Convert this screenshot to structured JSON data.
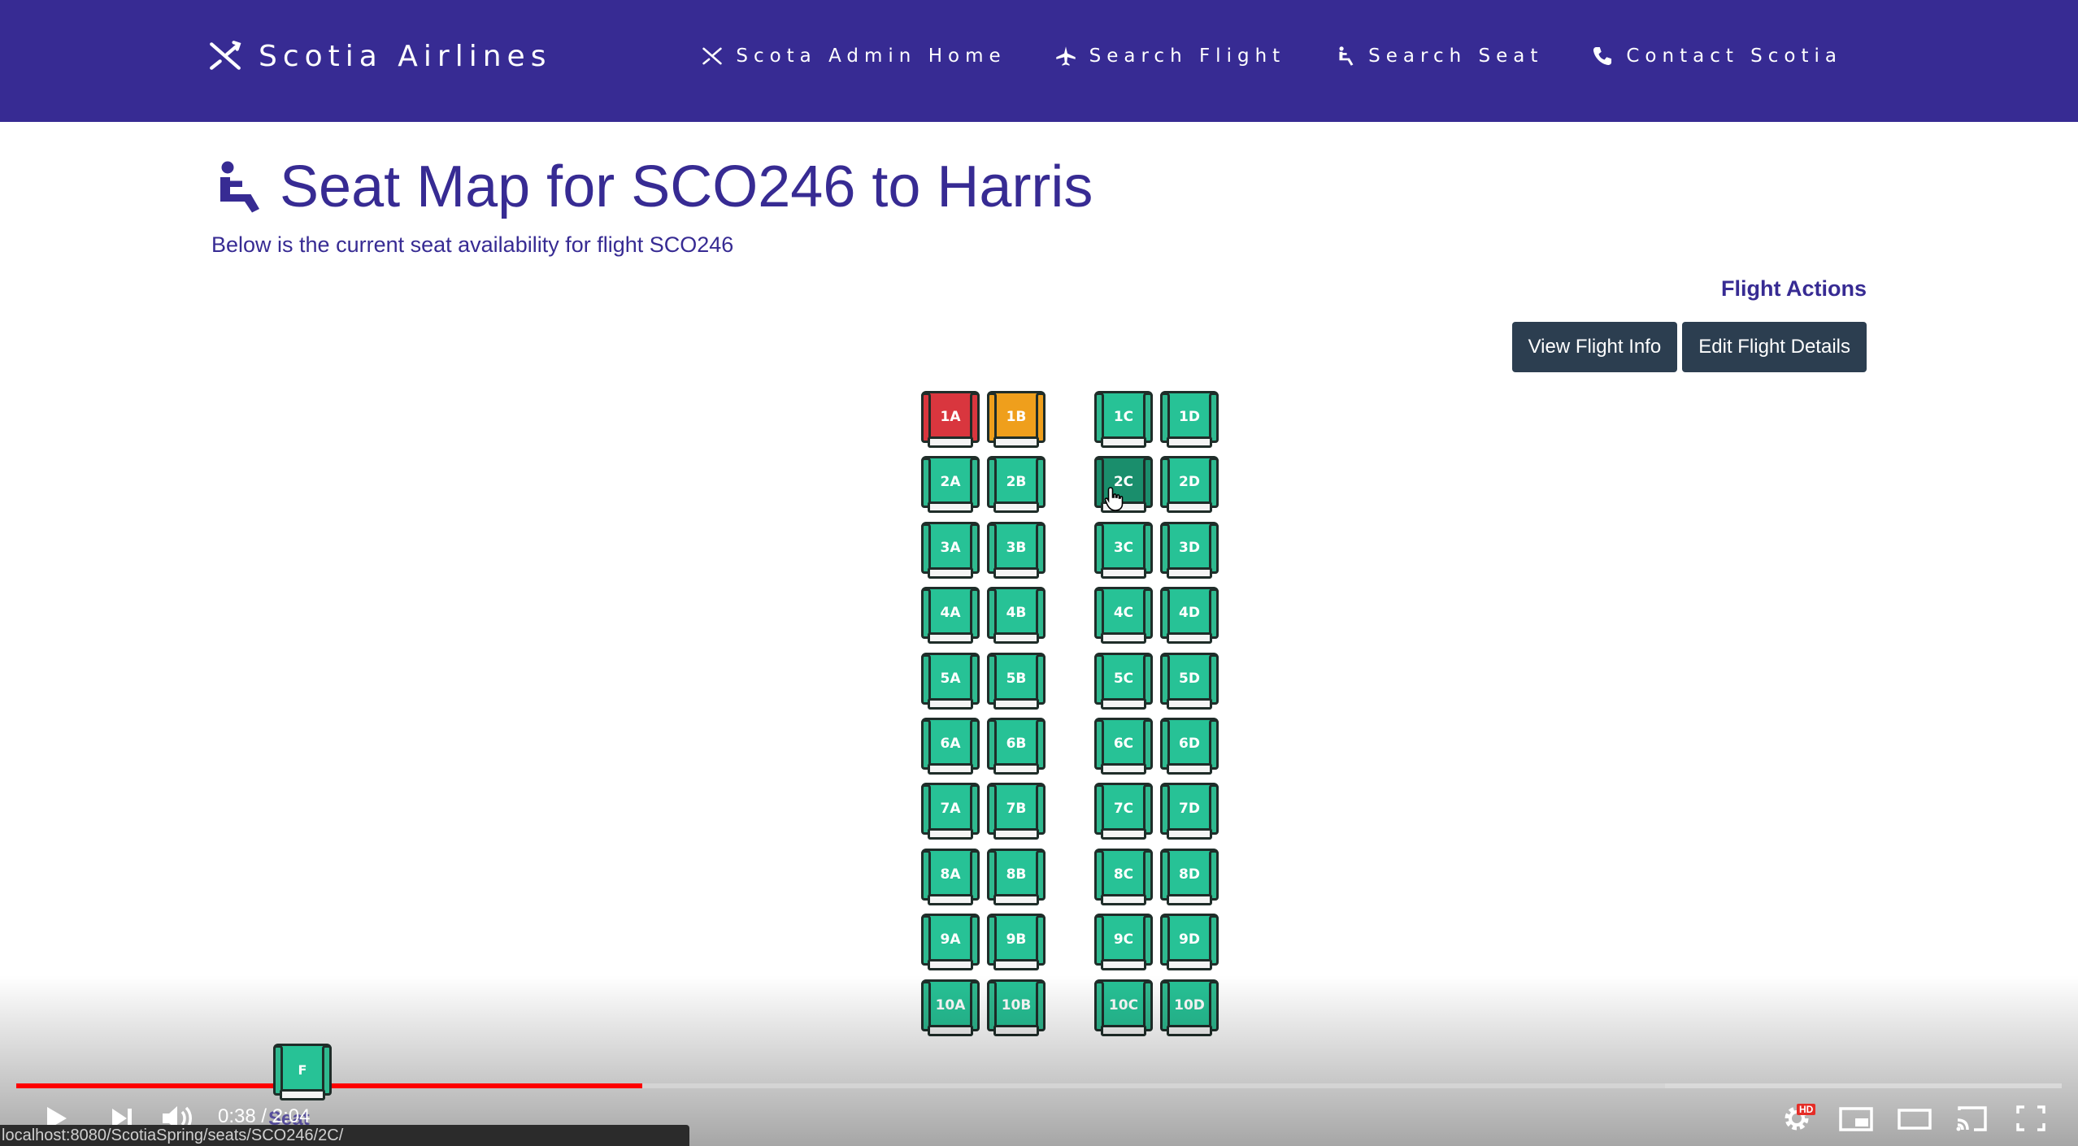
{
  "brand": {
    "name": "Scotia Airlines",
    "icon": "plane-x-icon"
  },
  "nav": [
    {
      "label": "Scota Admin Home",
      "icon": "plane-x-icon"
    },
    {
      "label": "Search Flight",
      "icon": "airplane-icon"
    },
    {
      "label": "Search Seat",
      "icon": "seat-icon"
    },
    {
      "label": "Contact Scotia",
      "icon": "phone-icon"
    }
  ],
  "header": {
    "title": "Seat Map for SCO246 to Harris",
    "title_icon": "seat-icon",
    "subtitle": "Below is the current seat availability for flight SCO246"
  },
  "actions": {
    "heading": "Flight Actions",
    "view_label": "View Flight Info",
    "edit_label": "Edit Flight Details"
  },
  "colors": {
    "navbar": "#372b93",
    "seat_available": "#27c296",
    "seat_booked": "#d9363e",
    "seat_reserved": "#ef9f1c",
    "seat_hover": "#1a8e6c",
    "button": "#2c3e50"
  },
  "seats": [
    {
      "label": "1A",
      "state": "booked"
    },
    {
      "label": "1B",
      "state": "reserved"
    },
    {
      "label": "1C",
      "state": "available"
    },
    {
      "label": "1D",
      "state": "available"
    },
    {
      "label": "2A",
      "state": "available"
    },
    {
      "label": "2B",
      "state": "available"
    },
    {
      "label": "2C",
      "state": "hover"
    },
    {
      "label": "2D",
      "state": "available"
    },
    {
      "label": "3A",
      "state": "available"
    },
    {
      "label": "3B",
      "state": "available"
    },
    {
      "label": "3C",
      "state": "available"
    },
    {
      "label": "3D",
      "state": "available"
    },
    {
      "label": "4A",
      "state": "available"
    },
    {
      "label": "4B",
      "state": "available"
    },
    {
      "label": "4C",
      "state": "available"
    },
    {
      "label": "4D",
      "state": "available"
    },
    {
      "label": "5A",
      "state": "available"
    },
    {
      "label": "5B",
      "state": "available"
    },
    {
      "label": "5C",
      "state": "available"
    },
    {
      "label": "5D",
      "state": "available"
    },
    {
      "label": "6A",
      "state": "available"
    },
    {
      "label": "6B",
      "state": "available"
    },
    {
      "label": "6C",
      "state": "available"
    },
    {
      "label": "6D",
      "state": "available"
    },
    {
      "label": "7A",
      "state": "available"
    },
    {
      "label": "7B",
      "state": "available"
    },
    {
      "label": "7C",
      "state": "available"
    },
    {
      "label": "7D",
      "state": "available"
    },
    {
      "label": "8A",
      "state": "available"
    },
    {
      "label": "8B",
      "state": "available"
    },
    {
      "label": "8C",
      "state": "available"
    },
    {
      "label": "8D",
      "state": "available"
    },
    {
      "label": "9A",
      "state": "available"
    },
    {
      "label": "9B",
      "state": "available"
    },
    {
      "label": "9C",
      "state": "available"
    },
    {
      "label": "9D",
      "state": "available"
    },
    {
      "label": "10A",
      "state": "available"
    },
    {
      "label": "10B",
      "state": "available"
    },
    {
      "label": "10C",
      "state": "available"
    },
    {
      "label": "10D",
      "state": "available"
    }
  ],
  "video": {
    "current_time": "0:38",
    "duration": "2:04",
    "time_display": "0:38 / 2:04",
    "played_fraction": 0.306,
    "buffered_fraction": 0.806,
    "thumbnail_label": "F",
    "behind_text": "Seat",
    "status_url": "localhost:8080/ScotiaSpring/seats/SCO246/2C/",
    "hd_badge": "HD"
  }
}
